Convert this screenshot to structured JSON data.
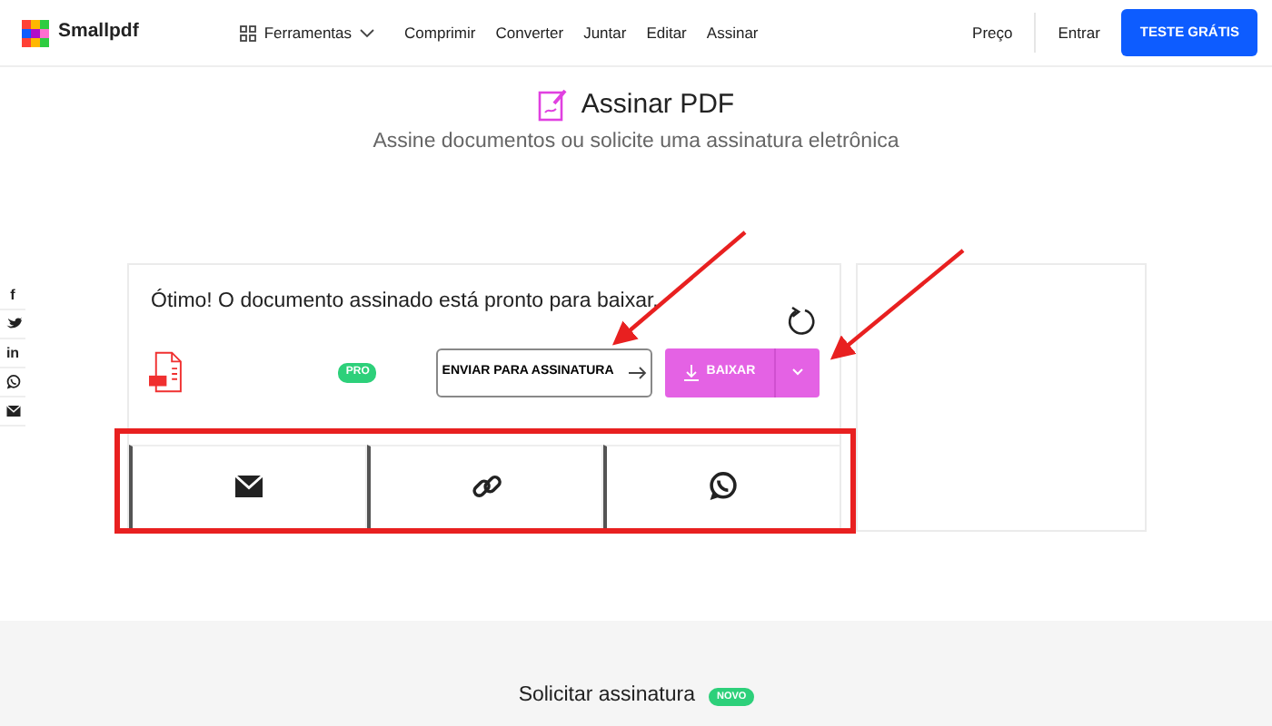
{
  "nav": {
    "logo": "Smallpdf",
    "tools": "Ferramentas",
    "links": [
      "Comprimir",
      "Converter",
      "Juntar",
      "Editar",
      "Assinar"
    ],
    "price": "Preço",
    "login": "Entrar",
    "cta": "TESTE GRÁTIS"
  },
  "social": [
    {
      "kind": "text",
      "label": "f"
    },
    {
      "kind": "twitter"
    },
    {
      "kind": "text",
      "label": "in"
    },
    {
      "kind": "whatsapp"
    },
    {
      "kind": "mail"
    }
  ],
  "header": {
    "title": "Assinar PDF",
    "subtitle": "Assine documentos ou solicite uma assinatura eletrônica"
  },
  "result": {
    "message": "Ótimo! O documento assinado está pronto para baixar.",
    "badge": "PRO",
    "send_button": "ENVIAR PARA ASSINATURA",
    "download_button": "BAIXAR",
    "share": [
      {
        "kind": "mail"
      },
      {
        "kind": "link"
      },
      {
        "kind": "whatsapp"
      }
    ]
  },
  "request": {
    "title": "Solicitar assinatura",
    "badge": "NOVO"
  }
}
